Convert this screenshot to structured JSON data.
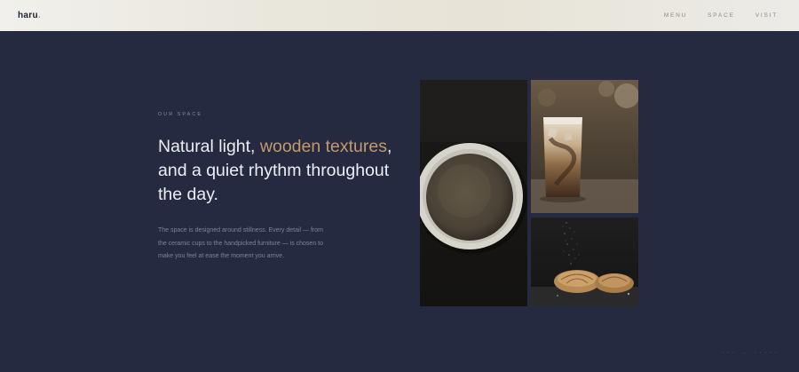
{
  "header": {
    "logo": "haru",
    "logo_dot": ".",
    "nav": [
      {
        "label": "MENU"
      },
      {
        "label": "SPACE"
      },
      {
        "label": "VISIT"
      }
    ]
  },
  "section": {
    "eyebrow": "OUR SPACE",
    "headline_start": "Natural light, ",
    "headline_accent": "wooden textures",
    "headline_end": ", and a quiet rhythm throughout the day.",
    "body": "The space is designed around stillness. Every detail — from the ceramic cups to the handpicked furniture — is chosen to make you feel at ease the moment you arrive."
  },
  "colors": {
    "background": "#252a40",
    "accent": "#c39a6a",
    "header_bg": "#ece9e1"
  },
  "gallery": {
    "images": [
      {
        "name": "coffee-cup-top-view"
      },
      {
        "name": "iced-latte-glass"
      },
      {
        "name": "croissants-on-board"
      }
    ]
  }
}
